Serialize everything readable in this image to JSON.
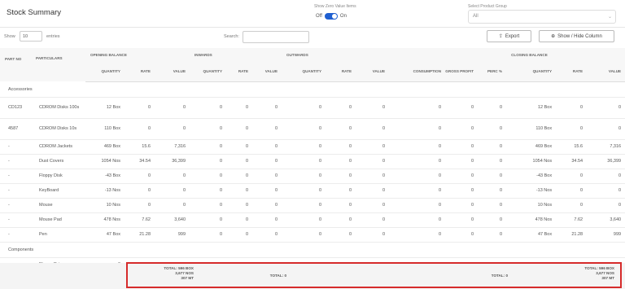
{
  "header": {
    "title": "Stock Summary",
    "zero_value_label": "Show Zero Value Items",
    "toggle_off": "Off",
    "toggle_on": "On",
    "product_group_label": "Select Product Group",
    "product_group_value": "All"
  },
  "controls": {
    "show_label": "Show",
    "page_size": "10",
    "entries_label": "entries",
    "search_label": "Search:",
    "search_value": "",
    "export_label": "Export",
    "columns_label": "Show / Hide Column"
  },
  "table": {
    "groups": {
      "part_no": "PART NO",
      "particulars": "PARTICULARS",
      "opening": "OPENING BALANCE",
      "inwards": "INWARDS",
      "outwards": "OUTWARDS",
      "closing": "CLOSING BALANCE"
    },
    "columns": [
      "QUANTITY",
      "RATE",
      "VALUE",
      "QUANTITY",
      "RATE",
      "VALUE",
      "QUANTITY",
      "RATE",
      "VALUE",
      "CONSUMPTION",
      "GROSS PROFIT",
      "PERC %",
      "QUANTITY",
      "RATE",
      "VALUE"
    ],
    "group_accessories": "Accessories",
    "group_components": "Components",
    "rows": [
      [
        "CD123",
        "CDROM Disks 100s",
        "12 Box",
        "0",
        "0",
        "0",
        "0",
        "0",
        "0",
        "0",
        "0",
        "0",
        "0",
        "0",
        "12 Box",
        "0",
        "0"
      ],
      [
        "4587",
        "CDROM Disks 10s",
        "110 Box",
        "0",
        "0",
        "0",
        "0",
        "0",
        "0",
        "0",
        "0",
        "0",
        "0",
        "0",
        "110 Box",
        "0",
        "0"
      ],
      [
        "-",
        "CDROM Jackets",
        "469 Box",
        "15.6",
        "7,316",
        "0",
        "0",
        "0",
        "0",
        "0",
        "0",
        "0",
        "0",
        "0",
        "469 Box",
        "15.6",
        "7,316"
      ],
      [
        "-",
        "Dust Covers",
        "1054 Nos",
        "34.54",
        "36,399",
        "0",
        "0",
        "0",
        "0",
        "0",
        "0",
        "0",
        "0",
        "0",
        "1054 Nos",
        "34.54",
        "36,399"
      ],
      [
        "-",
        "Floppy Disk",
        "-43 Box",
        "0",
        "0",
        "0",
        "0",
        "0",
        "0",
        "0",
        "0",
        "0",
        "0",
        "0",
        "-43 Box",
        "0",
        "0"
      ],
      [
        "-",
        "KeyBoard",
        "-13 Nos",
        "0",
        "0",
        "0",
        "0",
        "0",
        "0",
        "0",
        "0",
        "0",
        "0",
        "0",
        "-13 Nos",
        "0",
        "0"
      ],
      [
        "-",
        "Mouse",
        "10 Nos",
        "0",
        "0",
        "0",
        "0",
        "0",
        "0",
        "0",
        "0",
        "0",
        "0",
        "0",
        "10 Nos",
        "0",
        "0"
      ],
      [
        "-",
        "Mouse Pad",
        "478 Nos",
        "7.62",
        "3,640",
        "0",
        "0",
        "0",
        "0",
        "0",
        "0",
        "0",
        "0",
        "0",
        "478 Nos",
        "7.62",
        "3,640"
      ],
      [
        "-",
        "Pen",
        "47 Box",
        "21.28",
        "999",
        "0",
        "0",
        "0",
        "0",
        "0",
        "0",
        "0",
        "0",
        "0",
        "47 Box",
        "21.28",
        "999"
      ]
    ],
    "component_rows": [
      [
        "-",
        "Floppy Drive",
        "0",
        "0",
        "0",
        "0",
        "0",
        "0",
        "0",
        "0",
        "0",
        "0",
        "0",
        "0",
        "0",
        "0",
        "0"
      ]
    ]
  },
  "totals": {
    "opening_l1": "TOTAL: 596 BOX",
    "opening_l2": "3,677 NOS",
    "opening_l3": "307 MT",
    "inwards": "TOTAL: 0",
    "consumption": "TOTAL: 0",
    "closing_l1": "TOTAL: 596 BOX",
    "closing_l2": "3,677 NOS",
    "closing_l3": "307 MT"
  },
  "colors": {
    "accent": "#1f5fd1",
    "highlight": "#d62b2b"
  }
}
